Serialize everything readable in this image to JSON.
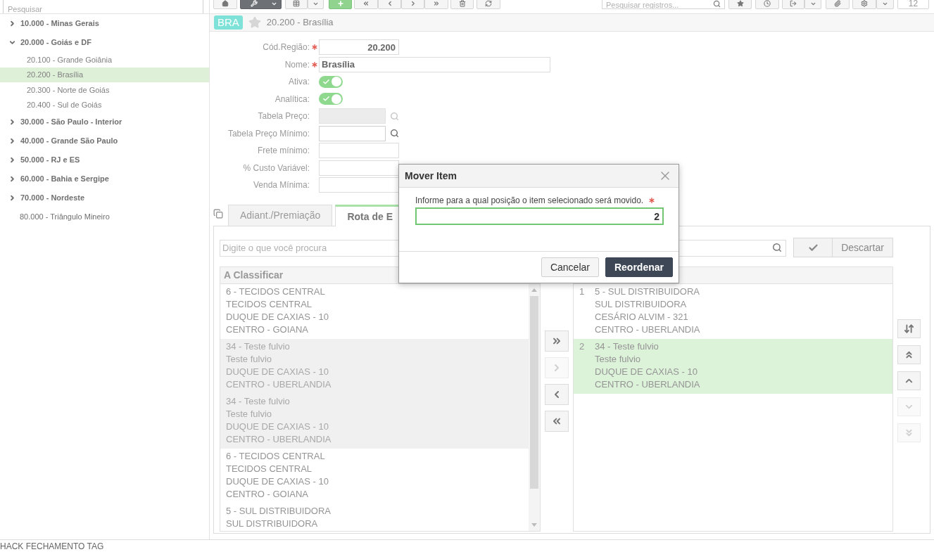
{
  "left_panel": {
    "search": {
      "placeholder": "Pesquisar"
    },
    "tree": [
      {
        "label": "10.000 - Minas Gerais",
        "kind": "group",
        "expanded": false,
        "selected": false
      },
      {
        "label": "20.000 - Goiás e DF",
        "kind": "group",
        "expanded": true,
        "selected": false,
        "children": [
          {
            "label": "20.100 - Grande Goiânia",
            "selected": false
          },
          {
            "label": "20.200 - Brasília",
            "selected": true
          },
          {
            "label": "20.300 - Norte de Goiás",
            "selected": false
          },
          {
            "label": "20.400 - Sul de Goiás",
            "selected": false
          }
        ]
      },
      {
        "label": "30.000 - São Paulo - Interior",
        "kind": "group",
        "expanded": false,
        "selected": false
      },
      {
        "label": "40.000 - Grande São Paulo",
        "kind": "group",
        "expanded": false,
        "selected": false
      },
      {
        "label": "50.000 - RJ e ES",
        "kind": "group",
        "expanded": false,
        "selected": false
      },
      {
        "label": "60.000 - Bahia e Sergipe",
        "kind": "group",
        "expanded": false,
        "selected": false
      },
      {
        "label": "70.000 - Nordeste",
        "kind": "group",
        "expanded": false,
        "selected": false
      },
      {
        "label": "80.000 - Triângulo Mineiro",
        "kind": "leaf",
        "selected": false
      }
    ]
  },
  "toolbar": {
    "search": {
      "placeholder": "Pesquisar registros..."
    },
    "record_count": "12"
  },
  "record_header": {
    "badge": "BRA",
    "favorite": false,
    "title": "20.200 - Brasília"
  },
  "form": {
    "fields": [
      {
        "label": "Cód.Região:",
        "kind": "number",
        "required": true,
        "value": "20.200"
      },
      {
        "label": "Nome:",
        "kind": "text",
        "required": true,
        "value": "Brasília"
      },
      {
        "label": "Ativa:",
        "kind": "toggle",
        "required": false,
        "on": true
      },
      {
        "label": "Analítica:",
        "kind": "toggle",
        "required": false,
        "on": true
      },
      {
        "label": "Tabela Preço:",
        "kind": "lookup",
        "required": false,
        "disabled": true
      },
      {
        "label": "Tabela Preço Mínimo:",
        "kind": "lookup",
        "required": false,
        "disabled": false
      },
      {
        "label": "Frete mínimo:",
        "kind": "number",
        "required": false
      },
      {
        "label": "% Custo Variável:",
        "kind": "number",
        "required": false
      },
      {
        "label": "Venda Mínima:",
        "kind": "number",
        "required": false
      }
    ]
  },
  "tabs": [
    {
      "label": "Adiant./Premiação",
      "selected": false
    },
    {
      "label": "Rota de E",
      "selected": true
    }
  ],
  "route_editor": {
    "search": {
      "placeholder": "Digite o que você procura"
    },
    "discard_button": "Descartar",
    "unsorted": {
      "title": "A Classificar",
      "items": [
        {
          "lines": [
            "6 - TECIDOS CENTRAL",
            "TECIDOS CENTRAL",
            "DUQUE DE CAXIAS - 10",
            "CENTRO - GOIANA"
          ],
          "disabled": false
        },
        {
          "lines": [
            "34 - Teste fulvio",
            "Teste fulvio",
            "DUQUE DE CAXIAS - 10",
            "CENTRO - UBERLANDIA"
          ],
          "disabled": true
        },
        {
          "lines": [
            "34 - Teste fulvio",
            "Teste fulvio",
            "DUQUE DE CAXIAS - 10",
            "CENTRO - UBERLANDIA"
          ],
          "disabled": true
        },
        {
          "lines": [
            "6 - TECIDOS CENTRAL",
            "TECIDOS CENTRAL",
            "DUQUE DE CAXIAS - 10",
            "CENTRO - GOIANA"
          ],
          "disabled": false
        },
        {
          "lines": [
            "5 - SUL DISTRIBUIDORA",
            "SUL DISTRIBUIDORA"
          ],
          "disabled": false
        }
      ]
    },
    "transfer_buttons": [
      {
        "kind": "all-right",
        "disabled": false
      },
      {
        "kind": "right",
        "disabled": true
      },
      {
        "kind": "left",
        "disabled": false
      },
      {
        "kind": "all-left",
        "disabled": false
      }
    ],
    "sorted": {
      "items": [
        {
          "number": "1",
          "lines": [
            "5 - SUL DISTRIBUIDORA",
            "SUL DISTRIBUIDORA",
            "CESÁRIO ALVIM - 321",
            "CENTRO - UBERLANDIA"
          ],
          "selected": false
        },
        {
          "number": "2",
          "lines": [
            "34 - Teste fulvio",
            "Teste fulvio",
            "DUQUE DE CAXIAS - 10",
            "CENTRO - UBERLANDIA"
          ],
          "selected": true
        }
      ]
    },
    "order_buttons": [
      {
        "kind": "sort",
        "disabled": false
      },
      {
        "kind": "top",
        "disabled": false
      },
      {
        "kind": "up",
        "disabled": false
      },
      {
        "kind": "down",
        "disabled": true
      },
      {
        "kind": "bottom",
        "disabled": true
      }
    ]
  },
  "dialog": {
    "title": "Mover Item",
    "prompt": "Informe para a qual posição o item selecionado será movido.",
    "required": true,
    "value": "2",
    "buttons": [
      {
        "label": "Cancelar",
        "kind": "secondary"
      },
      {
        "label": "Reordenar",
        "kind": "primary"
      }
    ]
  },
  "status_bar": {
    "text": "HACK FECHAMENTO TAG"
  }
}
